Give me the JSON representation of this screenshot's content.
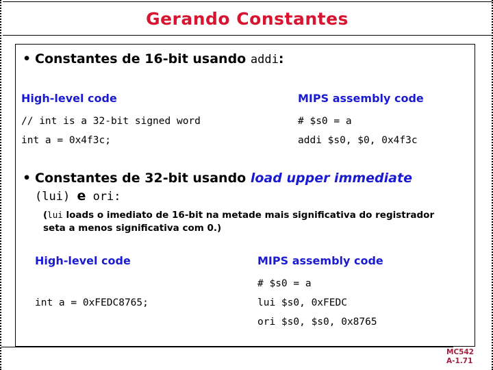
{
  "slide": {
    "title": "Gerando Constantes",
    "title_color": "#d81430",
    "accent_blue": "#1a1ad0",
    "footer_color": "#a02040"
  },
  "bullet1": {
    "dot": "•",
    "text_before": "Constantes de 16-bit usando ",
    "code_term": "addi",
    "text_after": ":"
  },
  "block1": {
    "left": {
      "header": "High-level code",
      "lines": [
        "// int is a 32-bit signed word",
        "int a = 0x4f3c;"
      ]
    },
    "right": {
      "header": "MIPS assembly code",
      "lines": [
        "# $s0 = a",
        "addi $s0, $0, 0x4f3c"
      ]
    }
  },
  "bullet2": {
    "dot": "•",
    "text_before": "Constantes de 32-bit usando ",
    "emphasis": "load upper immediate",
    "row2_open": "(",
    "row2_code1": "lui",
    "row2_mid": ") ",
    "row2_e": "e",
    "row2_code2": " ori:",
    "note_open": "(",
    "note_code": "lui",
    "note_text": " loads o imediato de 16-bit na  metade mais significativa do registrador  seta a menos significativa com 0.)"
  },
  "block2": {
    "left": {
      "header": "High-level code",
      "lines": [
        "",
        "int a = 0xFEDC8765;"
      ]
    },
    "right": {
      "header": "MIPS assembly code",
      "lines": [
        "# $s0 = a",
        "lui $s0, 0xFEDC",
        "ori $s0, $s0, 0x8765"
      ]
    }
  },
  "footer": {
    "course": "MC542",
    "page": "A-1.71"
  }
}
